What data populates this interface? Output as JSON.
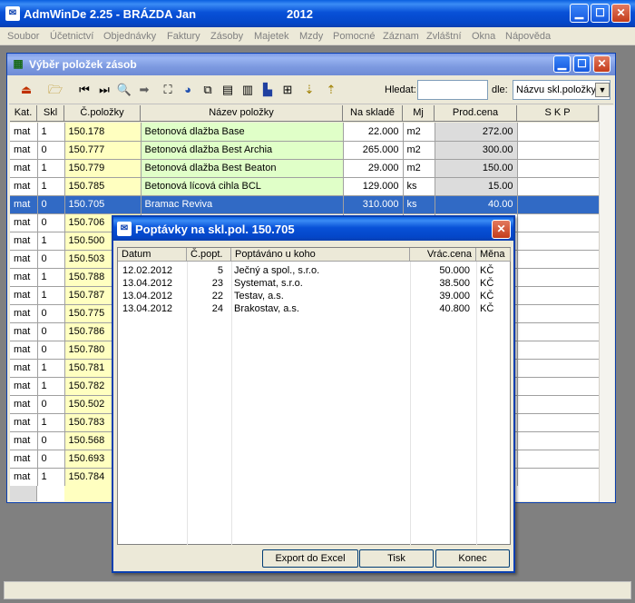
{
  "app": {
    "title": "AdmWinDe 2.25 - BRÁZDA Jan",
    "year": "2012",
    "menu": [
      "Soubor",
      "Účetnictví",
      "Objednávky",
      "Faktury",
      "Zásoby",
      "Majetek",
      "Mzdy",
      "Pomocné",
      "Záznam",
      "Zvláštní",
      "Okna",
      "Nápověda"
    ]
  },
  "child_window": {
    "title": "Výběr položek zásob",
    "search_label": "Hledat:",
    "search_value": "",
    "by_label": "dle:",
    "by_value": "Názvu skl.položky",
    "columns": [
      "Kat.",
      "Skl",
      "Č.položky",
      "Název položky",
      "Na skladě",
      "Mj",
      "Prod.cena",
      "S K P"
    ],
    "rows": [
      {
        "kat": "mat",
        "skl": "1",
        "cislo": "150.178",
        "nazev": "Betonová dlažba Base",
        "sklad": "22.000",
        "mj": "m2",
        "cena": "272.00"
      },
      {
        "kat": "mat",
        "skl": "0",
        "cislo": "150.777",
        "nazev": "Betonová dlažba Best Archia",
        "sklad": "265.000",
        "mj": "m2",
        "cena": "300.00"
      },
      {
        "kat": "mat",
        "skl": "1",
        "cislo": "150.779",
        "nazev": "Betonová dlažba Best Beaton",
        "sklad": "29.000",
        "mj": "m2",
        "cena": "150.00"
      },
      {
        "kat": "mat",
        "skl": "1",
        "cislo": "150.785",
        "nazev": "Betonová lícová cihla BCL",
        "sklad": "129.000",
        "mj": "ks",
        "cena": "15.00"
      },
      {
        "kat": "mat",
        "skl": "0",
        "cislo": "150.705",
        "nazev": "Bramac Reviva",
        "sklad": "310.000",
        "mj": "ks",
        "cena": "40.00"
      },
      {
        "kat": "mat",
        "skl": "0",
        "cislo": "150.706",
        "nazev": "",
        "sklad": "",
        "mj": "",
        "cena": ""
      },
      {
        "kat": "mat",
        "skl": "1",
        "cislo": "150.500",
        "nazev": "",
        "sklad": "",
        "mj": "",
        "cena": ""
      },
      {
        "kat": "mat",
        "skl": "0",
        "cislo": "150.503",
        "nazev": "",
        "sklad": "",
        "mj": "",
        "cena": ""
      },
      {
        "kat": "mat",
        "skl": "1",
        "cislo": "150.788",
        "nazev": "",
        "sklad": "",
        "mj": "",
        "cena": ""
      },
      {
        "kat": "mat",
        "skl": "1",
        "cislo": "150.787",
        "nazev": "",
        "sklad": "",
        "mj": "",
        "cena": ""
      },
      {
        "kat": "mat",
        "skl": "0",
        "cislo": "150.775",
        "nazev": "",
        "sklad": "",
        "mj": "",
        "cena": ""
      },
      {
        "kat": "mat",
        "skl": "0",
        "cislo": "150.786",
        "nazev": "",
        "sklad": "",
        "mj": "",
        "cena": ""
      },
      {
        "kat": "mat",
        "skl": "0",
        "cislo": "150.780",
        "nazev": "",
        "sklad": "",
        "mj": "",
        "cena": ""
      },
      {
        "kat": "mat",
        "skl": "1",
        "cislo": "150.781",
        "nazev": "",
        "sklad": "",
        "mj": "",
        "cena": ""
      },
      {
        "kat": "mat",
        "skl": "1",
        "cislo": "150.782",
        "nazev": "",
        "sklad": "",
        "mj": "",
        "cena": ""
      },
      {
        "kat": "mat",
        "skl": "0",
        "cislo": "150.502",
        "nazev": "",
        "sklad": "",
        "mj": "",
        "cena": ""
      },
      {
        "kat": "mat",
        "skl": "1",
        "cislo": "150.783",
        "nazev": "",
        "sklad": "",
        "mj": "",
        "cena": ""
      },
      {
        "kat": "mat",
        "skl": "0",
        "cislo": "150.568",
        "nazev": "",
        "sklad": "",
        "mj": "",
        "cena": ""
      },
      {
        "kat": "mat",
        "skl": "0",
        "cislo": "150.693",
        "nazev": "",
        "sklad": "",
        "mj": "",
        "cena": ""
      },
      {
        "kat": "mat",
        "skl": "1",
        "cislo": "150.784",
        "nazev": "",
        "sklad": "",
        "mj": "",
        "cena": ""
      }
    ]
  },
  "dialog": {
    "title": "Poptávky na skl.pol. 150.705",
    "columns": [
      "Datum",
      "Č.popt.",
      "Poptáváno u koho",
      "Vrác.cena",
      "Měna"
    ],
    "rows": [
      {
        "datum": "12.02.2012",
        "cislo": "5",
        "kdo": "Ječný a spol., s.r.o.",
        "cena": "50.000",
        "mena": "KČ"
      },
      {
        "datum": "13.04.2012",
        "cislo": "23",
        "kdo": "Systemat, s.r.o.",
        "cena": "38.500",
        "mena": "KČ"
      },
      {
        "datum": "13.04.2012",
        "cislo": "22",
        "kdo": "Testav, a.s.",
        "cena": "39.000",
        "mena": "KČ"
      },
      {
        "datum": "13.04.2012",
        "cislo": "24",
        "kdo": "Brakostav, a.s.",
        "cena": "40.800",
        "mena": "KČ"
      }
    ],
    "buttons": {
      "export": "Export do Excel",
      "print": "Tisk",
      "close": "Konec"
    }
  }
}
